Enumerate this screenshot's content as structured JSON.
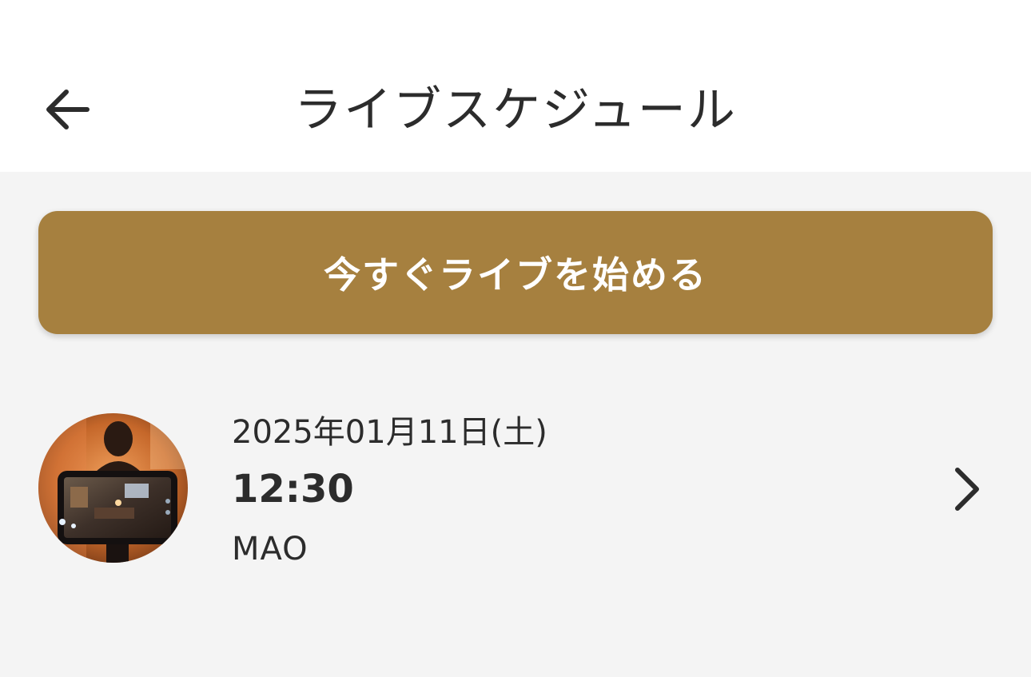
{
  "header": {
    "back_icon": "arrow-left-icon",
    "title": "ライブスケジュール"
  },
  "actions": {
    "start_live_label": "今すぐライブを始める",
    "accent_color": "#a6803f"
  },
  "schedule": [
    {
      "date": "2025年01月11日(土)",
      "time": "12:30",
      "host": "MAO",
      "thumbnail": "camera-streaming-photo",
      "chevron_icon": "chevron-right-icon"
    }
  ]
}
